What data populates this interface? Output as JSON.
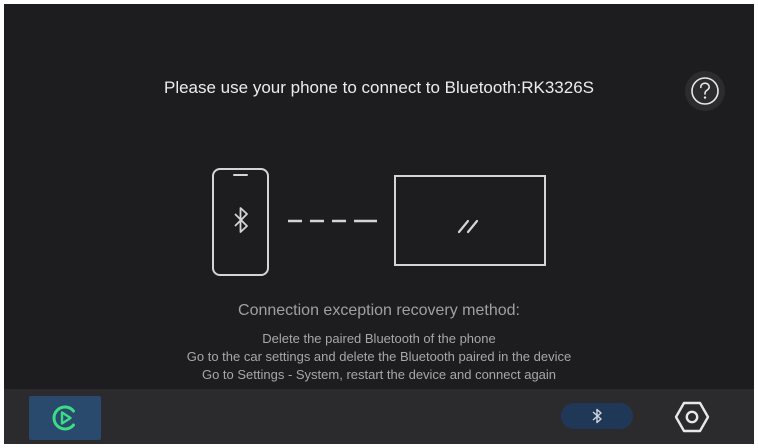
{
  "header": {
    "title": "Please use your phone to connect to Bluetooth:RK3326S"
  },
  "illustration": {
    "phone_icon": "phone-bluetooth-icon",
    "link_icon": "dashed-link-icon",
    "screen_icon": "car-display-icon"
  },
  "recovery": {
    "heading": "Connection exception recovery method:",
    "steps": [
      "Delete the paired Bluetooth of the phone",
      "Go to the car settings and delete the Bluetooth paired in the device",
      "Go to Settings - System, restart the device and connect again"
    ]
  },
  "bottom_bar": {
    "carplay_icon": "carplay-icon",
    "bluetooth_icon": "bluetooth-icon",
    "settings_icon": "settings-hexagon-icon"
  },
  "colors": {
    "background": "#1d1d1f",
    "bar": "#2b2b2d",
    "accent": "#29496d",
    "carplay_green": "#3ddc84"
  }
}
